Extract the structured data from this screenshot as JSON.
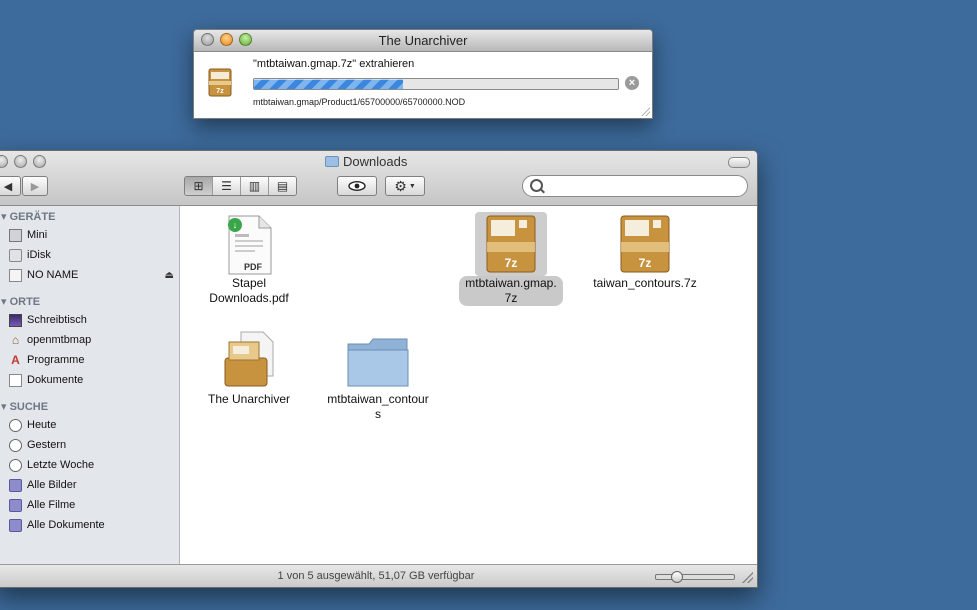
{
  "unarchiver": {
    "title": "The Unarchiver",
    "task_label": "\"mtbtaiwan.gmap.7z\" extrahieren",
    "progress_fraction": 0.41,
    "current_path": "mtbtaiwan.gmap/Product1/65700000/65700000.NOD",
    "archive_icon_text": "7z"
  },
  "finder": {
    "title": "Downloads",
    "search": {
      "value": "",
      "placeholder": ""
    },
    "sidebar": {
      "devices_header": "GERÄTE",
      "devices": [
        {
          "label": "Mini",
          "icon": "hard-drive-icon"
        },
        {
          "label": "iDisk",
          "icon": "idisk-icon"
        },
        {
          "label": "NO NAME",
          "icon": "removable-disk-icon"
        }
      ],
      "places_header": "ORTE",
      "places": [
        {
          "label": "Schreibtisch",
          "icon": "desktop-icon"
        },
        {
          "label": "openmtbmap",
          "icon": "home-icon"
        },
        {
          "label": "Programme",
          "icon": "applications-icon"
        },
        {
          "label": "Dokumente",
          "icon": "documents-icon"
        }
      ],
      "search_header": "SUCHE",
      "searches": [
        {
          "label": "Heute",
          "icon": "clock-icon"
        },
        {
          "label": "Gestern",
          "icon": "clock-icon"
        },
        {
          "label": "Letzte Woche",
          "icon": "clock-icon"
        },
        {
          "label": "Alle Bilder",
          "icon": "smart-folder-icon"
        },
        {
          "label": "Alle Filme",
          "icon": "smart-folder-icon"
        },
        {
          "label": "Alle Dokumente",
          "icon": "smart-folder-icon"
        }
      ]
    },
    "files": [
      {
        "line1": "Stapel",
        "line2": "Downloads.pdf",
        "type": "pdf",
        "badge": "PDF",
        "selected": false
      },
      {
        "line1": "mtbtaiwan.gmap.",
        "line2": "7z",
        "type": "7z",
        "badge": "7z",
        "selected": true
      },
      {
        "line1": "taiwan_contours.7z",
        "line2": "",
        "type": "7z",
        "badge": "7z",
        "selected": false
      },
      {
        "line1": "The Unarchiver",
        "line2": "",
        "type": "app",
        "selected": false
      },
      {
        "line1": "mtbtaiwan_contour",
        "line2": "s",
        "type": "folder",
        "selected": false
      }
    ],
    "status": "1 von 5 ausgewählt, 51,07 GB verfügbar",
    "icon_size_fraction": 0.25
  }
}
